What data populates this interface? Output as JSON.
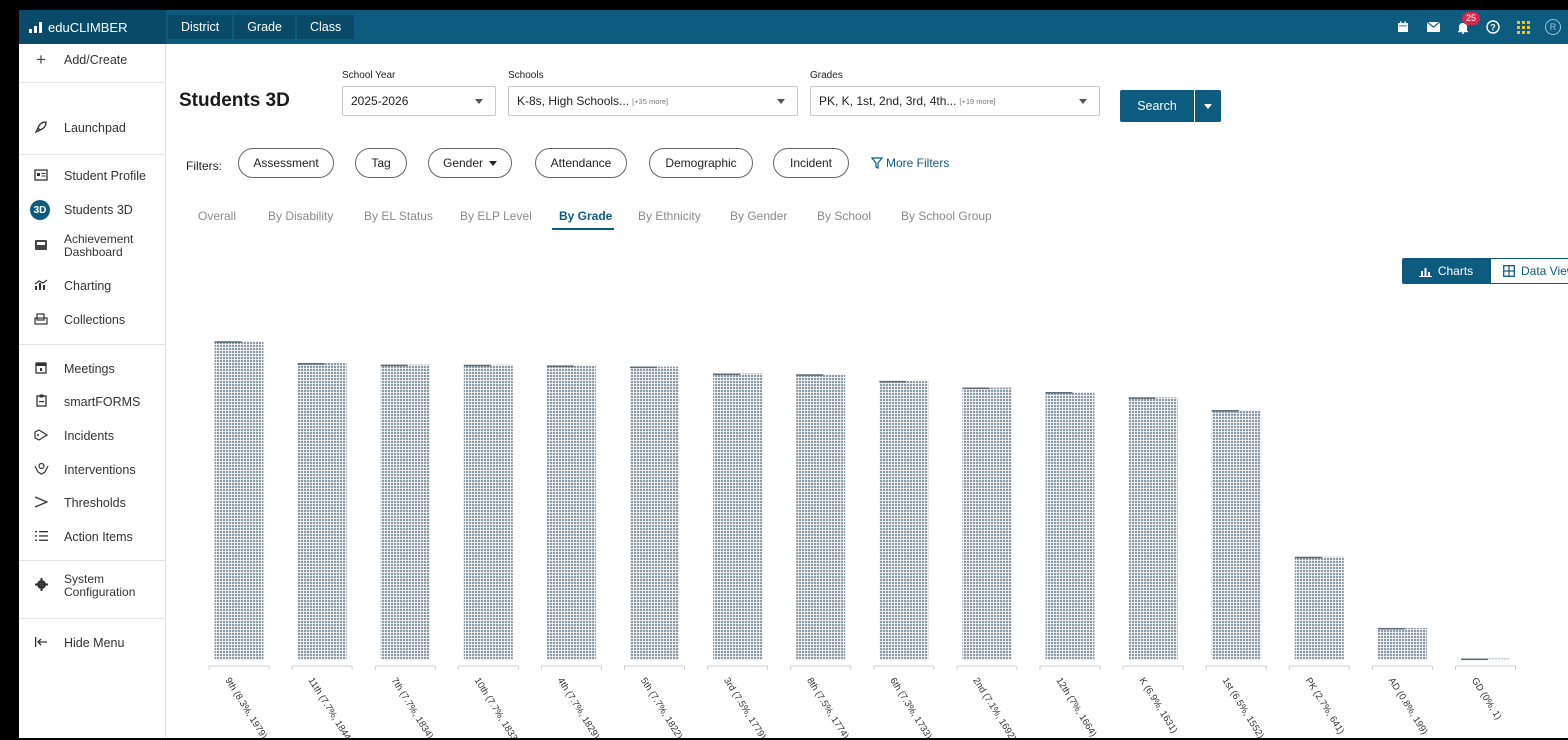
{
  "app": {
    "brand": "eduCLIMBER",
    "nav_tabs": [
      "District",
      "Grade",
      "Class"
    ],
    "notification_count": "25",
    "avatar_initial": "R",
    "accent_color": "#0d5c80",
    "top_icons": [
      "calendar-icon",
      "mail-icon",
      "bell-icon",
      "help-icon",
      "apps-grid-icon",
      "user-avatar"
    ]
  },
  "sidebar": {
    "items": [
      {
        "label": "Add/Create",
        "icon": "plus-icon"
      },
      {
        "label": "Launchpad",
        "icon": "rocket-icon"
      },
      {
        "label": "Student Profile",
        "icon": "id-card-icon"
      },
      {
        "label": "Students 3D",
        "icon": "3d-badge-icon",
        "badge": "3D"
      },
      {
        "label": "Achievement Dashboard",
        "icon": "dashboard-icon"
      },
      {
        "label": "Charting",
        "icon": "chart-icon"
      },
      {
        "label": "Collections",
        "icon": "collections-icon"
      },
      {
        "label": "Meetings",
        "icon": "calendar-icon"
      },
      {
        "label": "smartFORMS",
        "icon": "clipboard-icon"
      },
      {
        "label": "Incidents",
        "icon": "tag-icon"
      },
      {
        "label": "Interventions",
        "icon": "hands-icon"
      },
      {
        "label": "Thresholds",
        "icon": "threshold-icon"
      },
      {
        "label": "Action Items",
        "icon": "checklist-icon"
      },
      {
        "label": "System Configuration",
        "icon": "gear-icon"
      },
      {
        "label": "Hide Menu",
        "icon": "collapse-icon"
      }
    ]
  },
  "page": {
    "title": "Students 3D",
    "school_year": {
      "label": "School Year",
      "value": "2025-2026"
    },
    "schools": {
      "label": "Schools",
      "value": "K-8s, High Schools...",
      "more": "[+35 more]"
    },
    "grades": {
      "label": "Grades",
      "value": "PK, K, 1st, 2nd, 3rd, 4th...",
      "more": "[+19 more]"
    },
    "search_label": "Search",
    "filters_label": "Filters:",
    "filters": [
      "Assessment",
      "Tag",
      "Gender",
      "Attendance",
      "Demographic",
      "Incident"
    ],
    "more_filters": "More Filters",
    "tabs": [
      "Overall",
      "By Disability",
      "By EL Status",
      "By ELP Level",
      "By Grade",
      "By Ethnicity",
      "By Gender",
      "By School",
      "By School Group"
    ],
    "active_tab": "By Grade",
    "view_charts": "Charts",
    "view_data": "Data View"
  },
  "chart_data": {
    "type": "bar",
    "title": "",
    "xlabel": "",
    "ylabel": "",
    "bar_color": "#8a9aa6",
    "ylim": [
      0,
      1900
    ],
    "categories": [
      "9th (8.3%, 1979)",
      "11th (7.7%, 1844)",
      "7th (7.7%, 1834)",
      "10th (7.7%, 1833)",
      "4th (7.7%, 1829)",
      "5th (7.7%, 1822)",
      "3rd (7.5%, 1779)",
      "8th (7.5%, 1774)",
      "6th (7.3%, 1733)",
      "2nd (7.1%, 1692)",
      "12th (7%, 1664)",
      "K (6.9%, 1631)",
      "1st (6.5%, 1552)",
      "PK (2.7%, 641)",
      "AD (0.8%, 199)",
      "GD (0%, 1)"
    ],
    "values": [
      1979,
      1844,
      1834,
      1833,
      1829,
      1822,
      1779,
      1774,
      1733,
      1692,
      1664,
      1631,
      1552,
      641,
      199,
      1
    ]
  }
}
